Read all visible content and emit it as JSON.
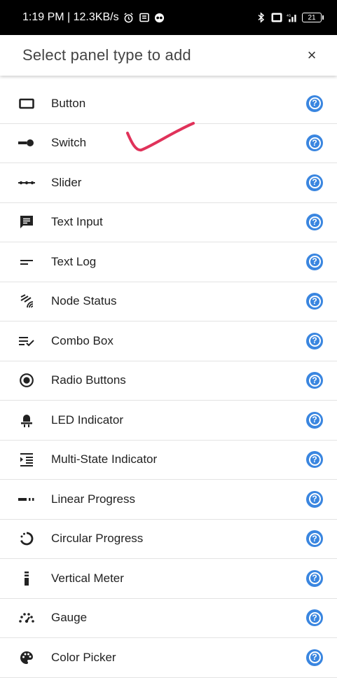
{
  "status_bar": {
    "time_speed": "1:19 PM | 12.3KB/s",
    "battery": "21",
    "signal": "4G"
  },
  "header": {
    "title": "Select panel type to add",
    "close": "×"
  },
  "items": [
    {
      "label": "Button",
      "icon": "button-icon"
    },
    {
      "label": "Switch",
      "icon": "switch-icon"
    },
    {
      "label": "Slider",
      "icon": "slider-icon"
    },
    {
      "label": "Text Input",
      "icon": "text-input-icon"
    },
    {
      "label": "Text Log",
      "icon": "text-log-icon"
    },
    {
      "label": "Node Status",
      "icon": "node-status-icon"
    },
    {
      "label": "Combo Box",
      "icon": "combo-box-icon"
    },
    {
      "label": "Radio Buttons",
      "icon": "radio-buttons-icon"
    },
    {
      "label": "LED Indicator",
      "icon": "led-indicator-icon"
    },
    {
      "label": "Multi-State Indicator",
      "icon": "multi-state-indicator-icon"
    },
    {
      "label": "Linear Progress",
      "icon": "linear-progress-icon"
    },
    {
      "label": "Circular Progress",
      "icon": "circular-progress-icon"
    },
    {
      "label": "Vertical Meter",
      "icon": "vertical-meter-icon"
    },
    {
      "label": "Gauge",
      "icon": "gauge-icon"
    },
    {
      "label": "Color Picker",
      "icon": "color-picker-icon"
    }
  ],
  "help_symbol": "?",
  "colors": {
    "help_blue": "#3a86e0",
    "checkmark": "#e0325a"
  }
}
